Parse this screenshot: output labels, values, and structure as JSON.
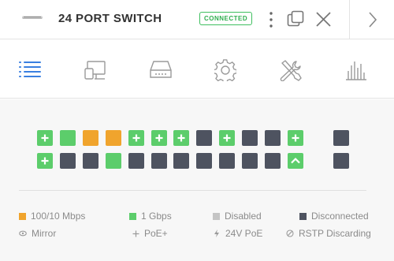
{
  "header": {
    "title": "24 PORT SWITCH",
    "status": "CONNECTED"
  },
  "tabs": [
    {
      "name": "details",
      "icon": "list-icon",
      "active": true
    },
    {
      "name": "device",
      "icon": "device-icon",
      "active": false
    },
    {
      "name": "storage",
      "icon": "drive-icon",
      "active": false
    },
    {
      "name": "settings",
      "icon": "gear-icon",
      "active": false
    },
    {
      "name": "tools",
      "icon": "tools-icon",
      "active": false
    },
    {
      "name": "statistics",
      "icon": "bar-chart-icon",
      "active": false
    }
  ],
  "ports": {
    "top_row": [
      "green-plus",
      "green",
      "orange",
      "orange",
      "green-plus",
      "green-plus",
      "green-plus",
      "dark",
      "green-plus",
      "dark",
      "dark",
      "green-plus"
    ],
    "bottom_row": [
      "green-plus",
      "dark",
      "dark",
      "green",
      "dark",
      "dark",
      "dark",
      "dark",
      "dark",
      "dark",
      "dark",
      "green-up"
    ],
    "sfp": [
      "dark",
      "dark"
    ]
  },
  "legend": {
    "speed_100_10": "100/10 Mbps",
    "speed_1g": "1 Gbps",
    "disabled": "Disabled",
    "disconnected": "Disconnected",
    "mirror": "Mirror",
    "poe_plus": "PoE+",
    "poe_24v": "24V PoE",
    "rstp": "RSTP Discarding"
  },
  "colors": {
    "accent": "#3a7fe0",
    "port_1g": "#5ccd6b",
    "port_100": "#f0a42d",
    "port_disabled": "#c4c4c4",
    "port_disconnected": "#4e5360",
    "connected": "#2fae4f"
  }
}
